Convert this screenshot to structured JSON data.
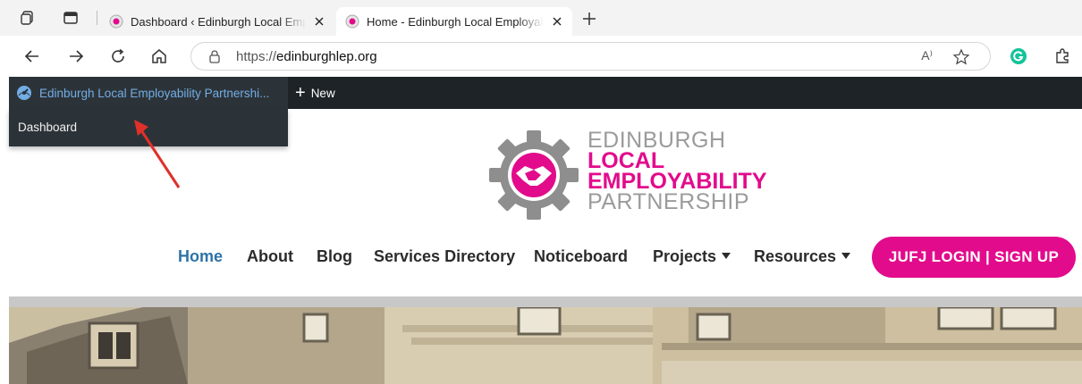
{
  "browser": {
    "tabs": [
      {
        "title": "Dashboard ‹ Edinburgh Local Employability Partnership",
        "active": false
      },
      {
        "title": "Home - Edinburgh Local Employability Partnership",
        "active": true
      }
    ],
    "url": {
      "scheme": "https://",
      "host": "edinburghlep.org"
    },
    "read_aloud": "A⁾"
  },
  "adminbar": {
    "site_name": "Edinburgh Local Employability Partnershi...",
    "new_label": "New",
    "submenu_item": "Dashboard"
  },
  "logo": {
    "line1": "EDINBURGH",
    "line2": "LOCAL",
    "line3": "EMPLOYABILITY",
    "line4": "PARTNERSHIP"
  },
  "nav": {
    "items": [
      {
        "label": "Home",
        "active": true
      },
      {
        "label": "About",
        "active": false
      },
      {
        "label": "Blog",
        "active": false
      },
      {
        "label": "Services Directory",
        "active": false
      },
      {
        "label": "Noticeboard",
        "active": false
      },
      {
        "label": "Projects",
        "active": false,
        "dropdown": true
      },
      {
        "label": "Resources",
        "active": false,
        "dropdown": true
      }
    ],
    "cta": "JUFJ LOGIN | SIGN UP"
  },
  "colors": {
    "brand_pink": "#e20b8c",
    "brand_grey": "#9b9b9b",
    "nav_active": "#2e73a8",
    "adminbar_bg": "#1d2327",
    "adminbar_link": "#72aee6",
    "annotation_arrow": "#e0302a"
  }
}
